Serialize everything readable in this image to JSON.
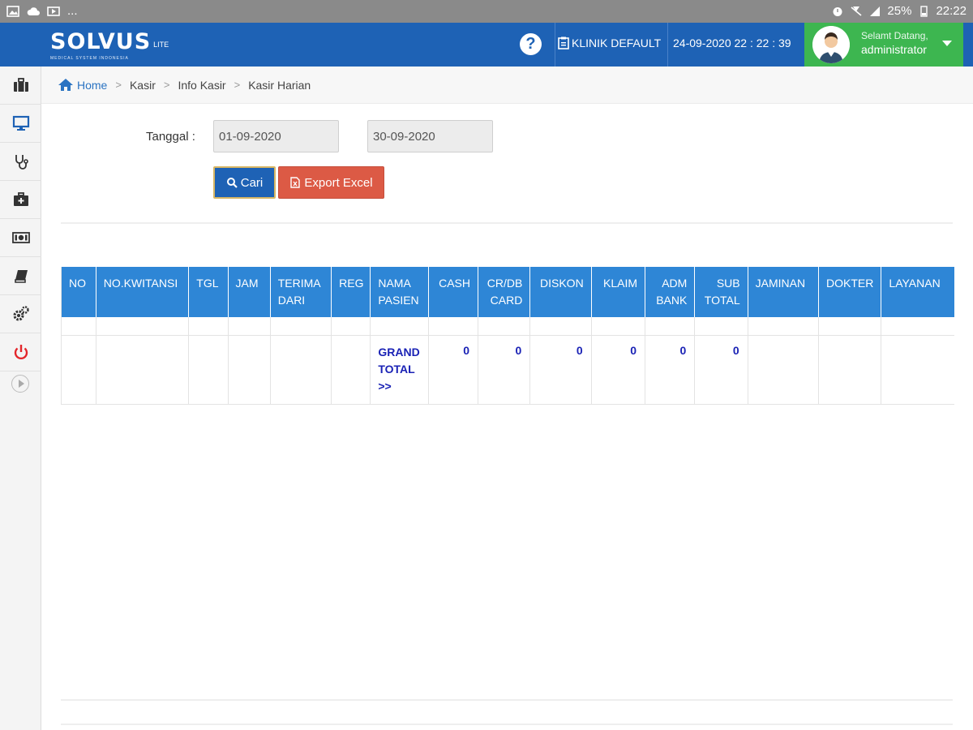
{
  "status_bar": {
    "ellipsis": "...",
    "battery_percent": "25%",
    "time": "22:22"
  },
  "header": {
    "brand": "SOLVUS",
    "edition": "LITE",
    "tagline": "MEDICAL SYSTEM INDONESIA",
    "help_label": "?",
    "clinic": "KLINIK DEFAULT",
    "datetime": "24-09-2020 22 : 22 : 39",
    "welcome": "Selamt Datang,",
    "username": "administrator",
    "colors": {
      "header_bg": "#1e62b5",
      "user_bg": "#3db650"
    }
  },
  "sidebar": {
    "items": [
      {
        "icon": "briefcase-icon"
      },
      {
        "icon": "monitor-icon",
        "active": true
      },
      {
        "icon": "stethoscope-icon"
      },
      {
        "icon": "medical-kit-icon"
      },
      {
        "icon": "money-icon"
      },
      {
        "icon": "book-icon"
      },
      {
        "icon": "gears-icon"
      },
      {
        "icon": "power-icon"
      }
    ]
  },
  "breadcrumb": {
    "home": "Home",
    "items": [
      "Kasir",
      "Info Kasir",
      "Kasir Harian"
    ],
    "separator": ">"
  },
  "filter": {
    "label": "Tanggal :",
    "date_from": "01-09-2020",
    "date_to": "30-09-2020",
    "search_button": "Cari",
    "export_button": "Export Excel"
  },
  "table": {
    "columns": [
      [
        "NO"
      ],
      [
        "NO.KWITANSI"
      ],
      [
        "TGL"
      ],
      [
        "JAM"
      ],
      [
        "TERIMA",
        "DARI"
      ],
      [
        "REG"
      ],
      [
        "NAMA",
        "PASIEN"
      ],
      [
        "CASH"
      ],
      [
        "CR/DB",
        "CARD"
      ],
      [
        "DISKON"
      ],
      [
        "KLAIM"
      ],
      [
        "ADM",
        "BANK"
      ],
      [
        "SUB",
        "TOTAL"
      ],
      [
        "JAMINAN"
      ],
      [
        "DOKTER"
      ],
      [
        "LAYANAN"
      ]
    ],
    "grand_total_label": [
      "GRAND",
      "TOTAL",
      ">>"
    ],
    "totals": {
      "cash": "0",
      "card": "0",
      "diskon": "0",
      "klaim": "0",
      "adm_bank": "0",
      "sub_total": "0"
    },
    "colors": {
      "header_bg": "#2e86d6",
      "total_text": "#1a22b5"
    }
  }
}
